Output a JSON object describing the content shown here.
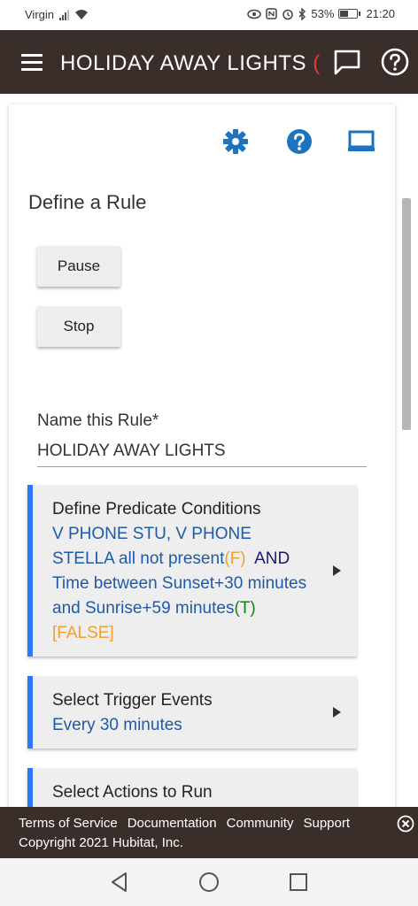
{
  "status_bar": {
    "carrier": "Virgin",
    "battery_percent": "53%",
    "battery_level": 0.53,
    "time": "21:20",
    "icons": [
      "signal-icon",
      "wifi-icon",
      "eye-icon",
      "nfc-icon",
      "alarm-icon",
      "bluetooth-icon",
      "battery-icon"
    ]
  },
  "header": {
    "title": "HOLIDAY AWAY LIGHTS",
    "title_overflow": "(",
    "icons": [
      "menu-icon",
      "chat-icon",
      "help-icon"
    ]
  },
  "toolbar_icons": [
    "gear-icon",
    "help-icon",
    "laptop-icon"
  ],
  "page": {
    "heading": "Define a Rule",
    "pause_label": "Pause",
    "stop_label": "Stop",
    "name_label": "Name this Rule*",
    "name_value": "HOLIDAY AWAY LIGHTS"
  },
  "sections": {
    "predicate": {
      "title": "Define Predicate Conditions",
      "cond1": "V PHONE STU, V PHONE STELLA all not present",
      "cond1_state": "(F)",
      "and": "AND",
      "cond2": "Time between Sunset+30 minutes and Sunrise+59 minutes",
      "cond2_state": "(T)",
      "result": "[FALSE]"
    },
    "triggers": {
      "title": "Select Trigger Events",
      "value": "Every 30 minutes"
    },
    "actions": {
      "title": "Select Actions to Run"
    }
  },
  "footer": {
    "links": [
      "Terms of Service",
      "Documentation",
      "Community",
      "Support"
    ],
    "copyright": "Copyright 2021 Hubitat, Inc."
  },
  "colors": {
    "header_bg": "#3a2e2a",
    "accent_blue": "#1e73be",
    "section_border": "#2979ff",
    "false_orange": "#f0a030",
    "true_green": "#1a7a1a"
  }
}
